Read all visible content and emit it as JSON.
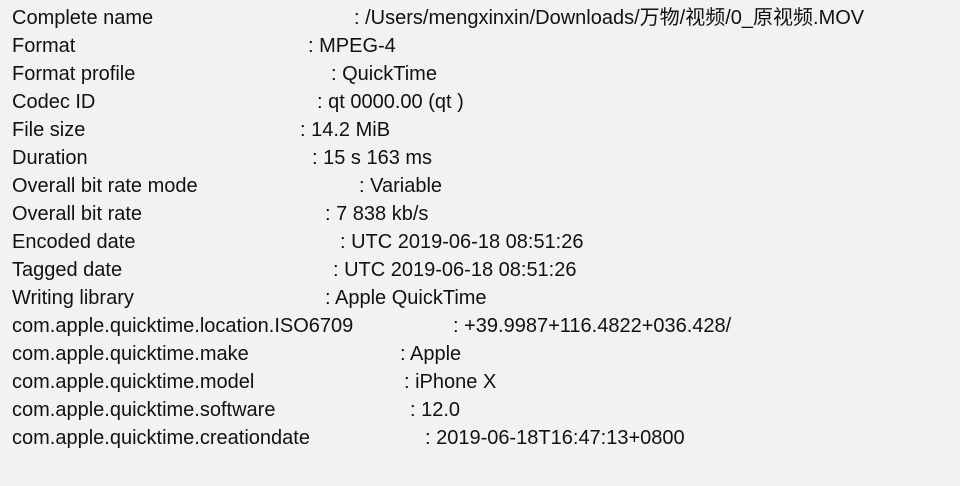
{
  "media_info": {
    "rows": [
      {
        "label": "Complete name",
        "value": ": /Users/mengxinxin/Downloads/万物/视频/0_原视频.MOV"
      },
      {
        "label": "Format",
        "value": ": MPEG-4"
      },
      {
        "label": "Format profile",
        "value": ": QuickTime"
      },
      {
        "label": "Codec ID",
        "value": ": qt   0000.00 (qt  )"
      },
      {
        "label": "File size",
        "value": ": 14.2 MiB"
      },
      {
        "label": "Duration",
        "value": ": 15 s 163 ms"
      },
      {
        "label": "Overall bit rate mode",
        "value": ": Variable"
      },
      {
        "label": "Overall bit rate",
        "value": ": 7 838 kb/s"
      },
      {
        "label": "Encoded date",
        "value": ": UTC 2019-06-18 08:51:26"
      },
      {
        "label": "Tagged date",
        "value": ": UTC 2019-06-18 08:51:26"
      },
      {
        "label": "Writing library",
        "value": ": Apple QuickTime"
      },
      {
        "label": "com.apple.quicktime.location.ISO6709",
        "value": ": +39.9987+116.4822+036.428/"
      },
      {
        "label": "com.apple.quicktime.make",
        "value": ": Apple"
      },
      {
        "label": "com.apple.quicktime.model",
        "value": ": iPhone X"
      },
      {
        "label": "com.apple.quicktime.software",
        "value": ": 12.0"
      },
      {
        "label": "com.apple.quicktime.creationdate",
        "value": ": 2019-06-18T16:47:13+0800"
      }
    ]
  }
}
